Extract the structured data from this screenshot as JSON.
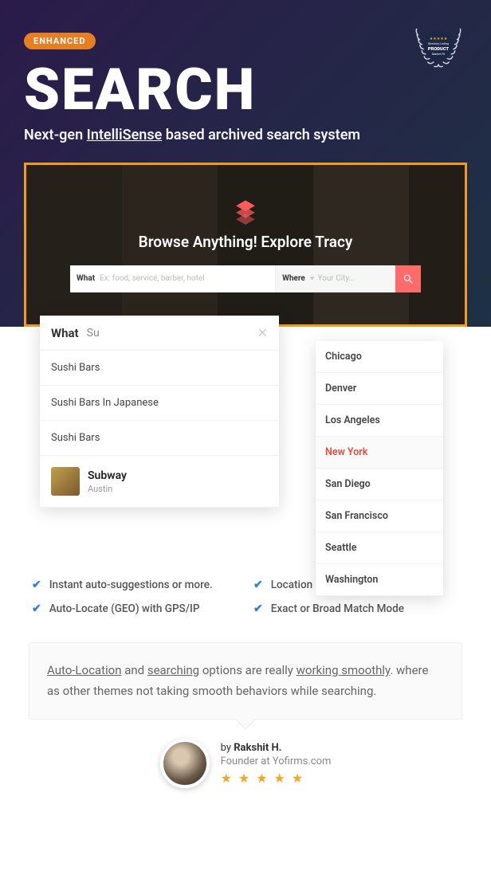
{
  "header": {
    "badge": "ENHANCED",
    "title": "SEARCH",
    "subtitle_pre": "Next-gen ",
    "subtitle_u": "IntelliSense",
    "subtitle_post": " based archived search system",
    "product_top": "Directory Listing",
    "product_mid": "PRODUCT",
    "product_bot": "Market Fit"
  },
  "demo": {
    "browse_text": "Browse Anything! Explore Tracy",
    "what_label": "What",
    "what_placeholder": "Ex: food, service, barber, hotel",
    "where_label": "Where",
    "where_placeholder": "Your City..."
  },
  "dd_what": {
    "label": "What",
    "query": "Su",
    "clear": "✕",
    "items": [
      {
        "label": "Sushi Bars"
      },
      {
        "label": "Sushi Bars In Japanese"
      },
      {
        "label": "Sushi Bars"
      }
    ],
    "rich": {
      "name": "Subway",
      "loc": "Austin"
    }
  },
  "dd_where": {
    "items": [
      "Chicago",
      "Denver",
      "Los Angeles",
      "New York",
      "San Diego",
      "San Francisco",
      "Seattle",
      "Washington"
    ],
    "active": "New York"
  },
  "features": [
    "Instant auto-suggestions or more.",
    "Location by Admin or Google",
    "Auto-Locate (GEO) with GPS/IP",
    "Exact or Broad Match Mode"
  ],
  "quote": {
    "p1_u1": "Auto-Location",
    "p1_t1": " and ",
    "p1_u2": "searching",
    "p1_t2": " options are really ",
    "p1_u3": "working smoothly",
    "p1_t3": ". where as other themes not taking smooth behaviors while searching."
  },
  "author": {
    "by_pre": "by ",
    "name": "Rakshit H.",
    "role": "Founder at Yofirms.com",
    "stars": "★ ★ ★ ★ ★"
  }
}
